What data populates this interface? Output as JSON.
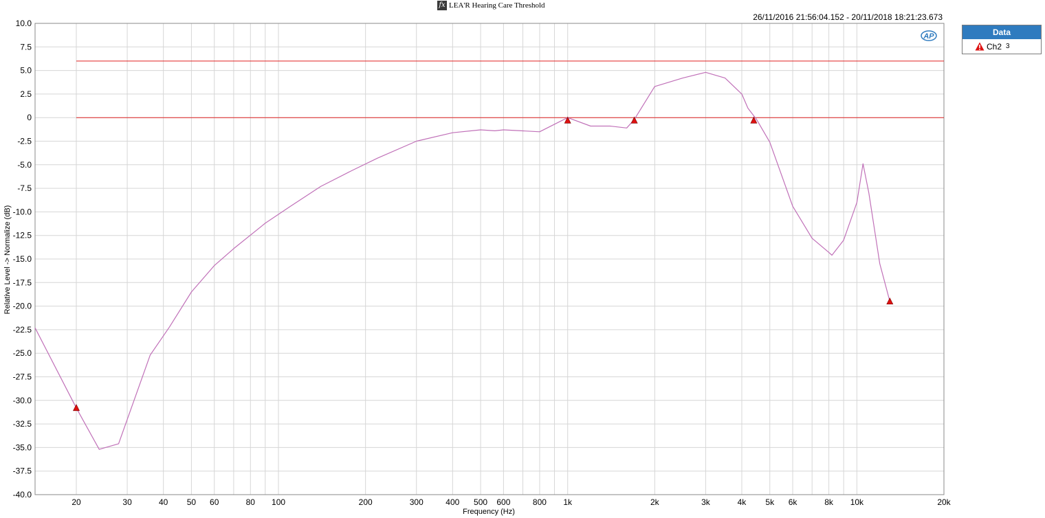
{
  "header": {
    "title": "LEA'R Hearing Care Threshold",
    "fx_glyph": "fx",
    "timestamp": "26/11/2016 21:56:04.152 - 20/11/2018 18:21:23.673",
    "logo_text": "AP"
  },
  "legend": {
    "header": "Data",
    "items": [
      {
        "label": "Ch2",
        "sub": "3",
        "color": "#c080c0",
        "marker": "warning-triangle-icon"
      }
    ]
  },
  "colors": {
    "curve": "#c070b8",
    "reference_lines": "#e02020",
    "marker": "#dd1111",
    "grid": "#d6d6d6",
    "legend_header": "#2f7bbf"
  },
  "chart_data": {
    "type": "line",
    "xscale": "log",
    "xlabel": "Frequency (Hz)",
    "ylabel": "Relative Level -> Normalize (dB)",
    "xlim": [
      14.4,
      20000
    ],
    "ylim": [
      -40,
      10
    ],
    "grid": true,
    "xtick_labels": [
      {
        "value": 20,
        "label": "20"
      },
      {
        "value": 30,
        "label": "30"
      },
      {
        "value": 40,
        "label": "40"
      },
      {
        "value": 50,
        "label": "50"
      },
      {
        "value": 60,
        "label": "60"
      },
      {
        "value": 80,
        "label": "80"
      },
      {
        "value": 100,
        "label": "100"
      },
      {
        "value": 200,
        "label": "200"
      },
      {
        "value": 300,
        "label": "300"
      },
      {
        "value": 400,
        "label": "400"
      },
      {
        "value": 500,
        "label": "500"
      },
      {
        "value": 600,
        "label": "600"
      },
      {
        "value": 800,
        "label": "800"
      },
      {
        "value": 1000,
        "label": "1k"
      },
      {
        "value": 2000,
        "label": "2k"
      },
      {
        "value": 3000,
        "label": "3k"
      },
      {
        "value": 4000,
        "label": "4k"
      },
      {
        "value": 5000,
        "label": "5k"
      },
      {
        "value": 6000,
        "label": "6k"
      },
      {
        "value": 8000,
        "label": "8k"
      },
      {
        "value": 10000,
        "label": "10k"
      },
      {
        "value": 20000,
        "label": "20k"
      }
    ],
    "ytick_labels": [
      "10.0",
      "7.5",
      "5.0",
      "2.5",
      "0",
      "-2.5",
      "-5.0",
      "-7.5",
      "-10.0",
      "-12.5",
      "-15.0",
      "-17.5",
      "-20.0",
      "-22.5",
      "-25.0",
      "-27.5",
      "-30.0",
      "-32.5",
      "-35.0",
      "-37.5",
      "-40.0"
    ],
    "reference_lines": [
      {
        "y": 6,
        "x_from": 20,
        "x_to": 20000
      },
      {
        "y": 0,
        "x_from": 20,
        "x_to": 20000
      }
    ],
    "series": [
      {
        "name": "Ch2",
        "x": [
          14.4,
          20,
          24,
          28,
          36,
          42,
          50,
          60,
          70,
          90,
          110,
          140,
          180,
          220,
          300,
          400,
          500,
          560,
          600,
          800,
          1000,
          1200,
          1400,
          1600,
          1700,
          2000,
          2500,
          3000,
          3500,
          4000,
          4200,
          4500,
          5000,
          6000,
          7000,
          8000,
          8200,
          9000,
          10000,
          10500,
          11000,
          12000,
          13000
        ],
        "y": [
          -22.3,
          -30.8,
          -35.2,
          -34.6,
          -25.2,
          -22.2,
          -18.5,
          -15.7,
          -13.9,
          -11.2,
          -9.4,
          -7.3,
          -5.6,
          -4.3,
          -2.5,
          -1.6,
          -1.3,
          -1.4,
          -1.3,
          -1.5,
          0,
          -0.9,
          -0.9,
          -1.1,
          -0.2,
          3.3,
          4.2,
          4.8,
          4.2,
          2.5,
          1.0,
          -0.2,
          -2.6,
          -9.4,
          -12.8,
          -14.3,
          -14.6,
          -13.0,
          -9.0,
          -4.9,
          -8.0,
          -15.5,
          -19.5
        ]
      }
    ],
    "markers": [
      {
        "x": 20,
        "y": -30.8
      },
      {
        "x": 1000,
        "y": -0.3
      },
      {
        "x": 1700,
        "y": -0.3
      },
      {
        "x": 4400,
        "y": -0.3
      },
      {
        "x": 13000,
        "y": -19.5
      }
    ]
  }
}
